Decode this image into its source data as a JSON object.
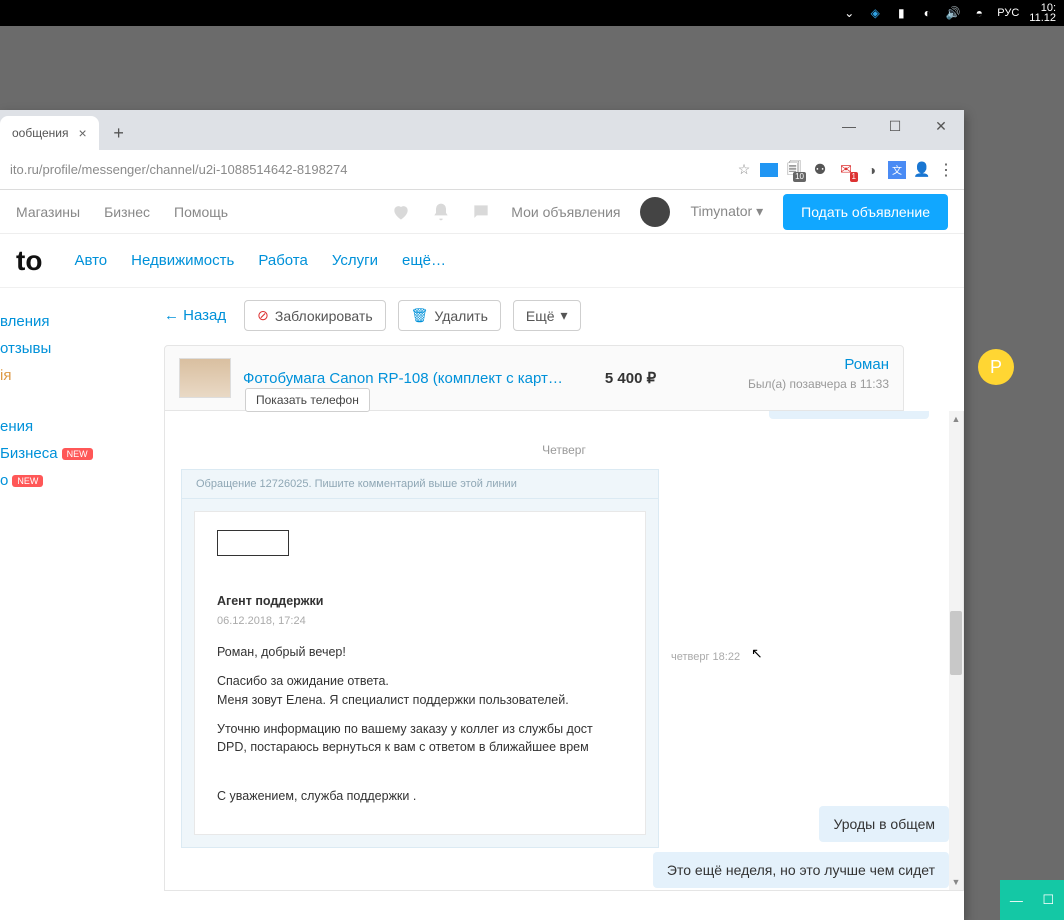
{
  "taskbar": {
    "lang": "РУС",
    "time": "10:",
    "date": "11.12"
  },
  "browser": {
    "tab": {
      "title": "ообщения"
    },
    "url": "ito.ru/profile/messenger/channel/u2i-1088514642-8198274",
    "ext_badge": "10",
    "mail_badge": "1"
  },
  "header": {
    "nav": [
      "Магазины",
      "Бизнес",
      "Помощь"
    ],
    "my_ads": "Мои объявления",
    "username": "Timynator",
    "cta": "Подать объявление"
  },
  "categories": {
    "logo": "to",
    "items": [
      "Авто",
      "Недвижимость",
      "Работа",
      "Услуги",
      "ещё…"
    ]
  },
  "sidebar": {
    "items": [
      {
        "label": "вления",
        "new": false
      },
      {
        "label": "отзывы",
        "new": false
      },
      {
        "label": "ія",
        "new": false
      },
      {
        "label": "",
        "spacer": true
      },
      {
        "label": "ения",
        "new": false
      },
      {
        "label": "Бизнеса",
        "new": true
      },
      {
        "label": "о",
        "new": true
      }
    ]
  },
  "toolbar": {
    "back": "← Назад",
    "block": "Заблокировать",
    "delete": "Удалить",
    "more": "Ещё"
  },
  "product": {
    "title": "Фотобумага Canon RP-108 (комплект с карт…",
    "price": "5 400 ₽",
    "show_phone": "Показать телефон"
  },
  "peer": {
    "name": "Роман",
    "status": "Был(а) позавчера в 11:33",
    "initial": "Р"
  },
  "chat": {
    "day": "Четверг",
    "msg_head": "Обращение 12726025. Пишите комментарий выше этой линии",
    "letter": {
      "agent": "Агент поддержки",
      "stamp": "06.12.2018, 17:24",
      "greeting": "Роман, добрый вечер!",
      "p1": "Спасибо за ожидание ответа.",
      "p2": "Меня зовут Елена. Я специалист поддержки пользователей.",
      "p3": "Уточню информацию по вашему заказу у коллег из службы дост DPD, постараюсь вернуться к вам с ответом в ближайшее врем",
      "sign": "С уважением, служба поддержки ."
    },
    "meta": "четверг 18:22",
    "bubble1": "Уроды в общем",
    "bubble2": "Это ещё неделя, но это лучше чем сидет"
  }
}
